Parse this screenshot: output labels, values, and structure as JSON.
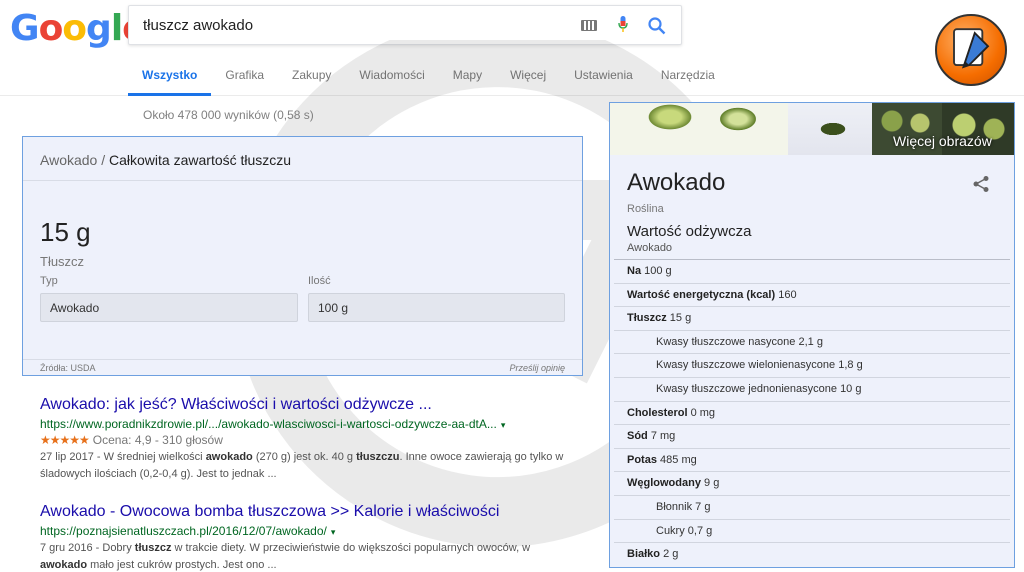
{
  "logo": {
    "letters": [
      "G",
      "o",
      "o",
      "g",
      "l",
      "e"
    ],
    "colors": [
      "#4285f4",
      "#ea4335",
      "#fbbc05",
      "#4285f4",
      "#34a853",
      "#ea4335"
    ]
  },
  "search": {
    "query": "tłuszcz awokado"
  },
  "tabs": [
    {
      "label": "Wszystko",
      "active": true
    },
    {
      "label": "Grafika"
    },
    {
      "label": "Zakupy"
    },
    {
      "label": "Wiadomości"
    },
    {
      "label": "Mapy"
    },
    {
      "label": "Więcej"
    },
    {
      "label": "Ustawienia"
    },
    {
      "label": "Narzędzia"
    }
  ],
  "result_stats": "Około 478 000 wyników (0,58 s)",
  "answer": {
    "crumb1": "Awokado",
    "separator": "/",
    "crumb2": "Całkowita zawartość tłuszczu",
    "value": "15 g",
    "label": "Tłuszcz",
    "type_label": "Typ",
    "type_value": "Awokado",
    "amount_label": "Ilość",
    "amount_value": "100 g",
    "source": "Źródła: USDA",
    "feedback": "Prześlij opinię"
  },
  "results": [
    {
      "title": "Awokado: jak jeść? Właściwości i wartości odżywcze ...",
      "url": "https://www.poradnikzdrowie.pl/.../awokado-wlasciwosci-i-wartosci-odzywcze-aa-dtA...",
      "caret": "▾",
      "stars": "★★★★★",
      "rating": 4.9,
      "rating_text": "Ocena: 4,9 - 310 głosów",
      "snippet_parts": [
        "27 lip 2017 - W średniej wielkości ",
        "awokado",
        " (270 g) jest ok. 40 g ",
        "tłuszczu",
        ". Inne owoce zawierają go tylko w śladowych ilościach (0,2-0,4 g). Jest to jednak ..."
      ]
    },
    {
      "title": "Awokado - Owocowa bomba tłuszczowa >> Kalorie i właściwości",
      "url": "https://poznajsienatluszczach.pl/2016/12/07/awokado/",
      "caret": "▾",
      "snippet_parts": [
        "7 gru 2016 - Dobry ",
        "tłuszcz",
        " w trakcie diety. W przeciwieństwie do większości popularnych owoców, w ",
        "awokado",
        " mało jest cukrów prostych. Jest ono ..."
      ]
    }
  ],
  "knowledge_panel": {
    "more_images": "Więcej obrazów",
    "title": "Awokado",
    "subtitle": "Roślina",
    "section": "Wartość odżywcza",
    "section_sub": "Awokado",
    "rows": [
      {
        "label": "Na",
        "value": "100 g",
        "bold": true
      },
      {
        "label": "Wartość energetyczna (kcal)",
        "value": "160",
        "bold": true
      },
      {
        "label": "Tłuszcz",
        "value": "15 g",
        "bold": true
      },
      {
        "label": "Kwasy tłuszczowe nasycone",
        "value": "2,1 g",
        "indent": true
      },
      {
        "label": "Kwasy tłuszczowe wielonienasycone",
        "value": "1,8 g",
        "indent": true
      },
      {
        "label": "Kwasy tłuszczowe jednonienasycone",
        "value": "10 g",
        "indent": true
      },
      {
        "label": "Cholesterol",
        "value": "0 mg",
        "bold": true
      },
      {
        "label": "Sód",
        "value": "7 mg",
        "bold": true
      },
      {
        "label": "Potas",
        "value": "485 mg",
        "bold": true
      },
      {
        "label": "Węglowodany",
        "value": "9 g",
        "bold": true
      },
      {
        "label": "Błonnik",
        "value": "7 g",
        "indent": true
      },
      {
        "label": "Cukry",
        "value": "0,7 g",
        "indent": true
      },
      {
        "label": "Białko",
        "value": "2 g",
        "bold": true
      }
    ]
  }
}
